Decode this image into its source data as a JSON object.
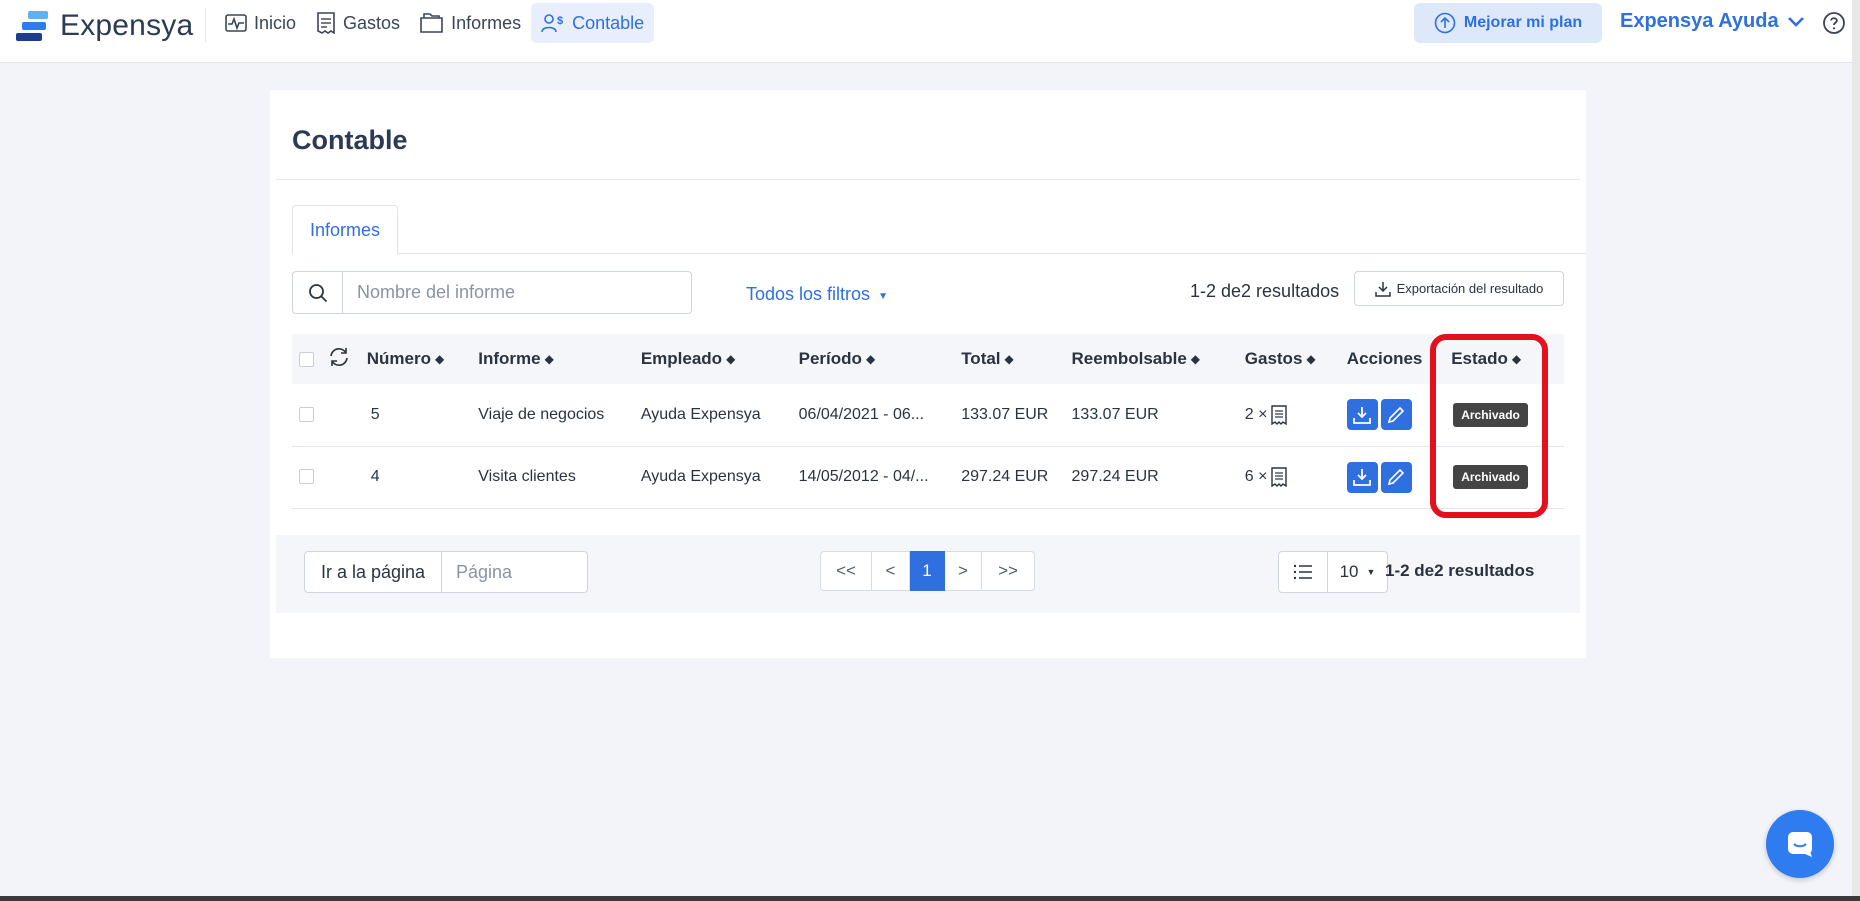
{
  "brand": {
    "name": "Expensya"
  },
  "nav": {
    "items": [
      {
        "label": "Inicio",
        "icon": "activity-icon"
      },
      {
        "label": "Gastos",
        "icon": "receipt-icon"
      },
      {
        "label": "Informes",
        "icon": "folder-icon"
      },
      {
        "label": "Contable",
        "icon": "accounting-users-icon",
        "active": true
      }
    ]
  },
  "header": {
    "upgrade_label": "Mejorar mi plan",
    "user_name": "Expensya Ayuda",
    "help_icon": "help-circle-icon"
  },
  "page": {
    "title": "Contable",
    "tab": "Informes",
    "search_placeholder": "Nombre del informe",
    "filters_label": "Todos los filtros",
    "results_text": "1-2 de2 resultados",
    "export_label": "Exportación del resultado"
  },
  "table": {
    "headers": {
      "numero": "Número",
      "informe": "Informe",
      "empleado": "Empleado",
      "periodo": "Período",
      "total": "Total",
      "reembolsable": "Reembolsable",
      "gastos": "Gastos",
      "acciones": "Acciones",
      "estado": "Estado"
    },
    "rows": [
      {
        "numero": "5",
        "informe": "Viaje de negocios",
        "empleado": "Ayuda Expensya",
        "periodo": "06/04/2021 - 06...",
        "total": "133.07 EUR",
        "reembolsable": "133.07 EUR",
        "gastos": "2 ×",
        "estado": "Archivado"
      },
      {
        "numero": "4",
        "informe": "Visita clientes",
        "empleado": "Ayuda Expensya",
        "periodo": "14/05/2012 - 04/...",
        "total": "297.24 EUR",
        "reembolsable": "297.24 EUR",
        "gastos": "6 ×",
        "estado": "Archivado"
      }
    ]
  },
  "pagination": {
    "goto_label": "Ir a la página",
    "page_placeholder": "Página",
    "first": "<<",
    "prev": "<",
    "current": "1",
    "next": ">",
    "last": ">>",
    "per_page": "10",
    "results_text": "1-2 de2 resultados"
  },
  "colors": {
    "accent": "#2f6fe0",
    "highlight": "#e3101e",
    "badge": "#444444"
  }
}
